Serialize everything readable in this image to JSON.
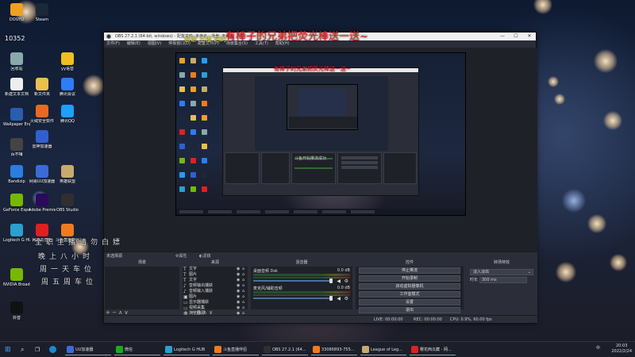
{
  "desktop": {
    "icons": [
      {
        "label": "DOUYU",
        "color": "#f0a020"
      },
      {
        "label": "回收站",
        "color": "#8aa"
      },
      {
        "label": "新建文本文档",
        "color": "#eee"
      },
      {
        "label": "新文件夹",
        "color": "#e8c050"
      },
      {
        "label": "腾讯会议",
        "color": "#2e7cf6"
      },
      {
        "label": "Wallpaper Engine",
        "color": "#2a5db0"
      },
      {
        "label": "百不嗨",
        "color": "#444"
      },
      {
        "label": "Bandizip",
        "color": "#2a7de1"
      },
      {
        "label": "GeForce Experience",
        "color": "#76b900"
      },
      {
        "label": "Logitech G HUB",
        "color": "#2aa0d0"
      },
      {
        "label": "NVIDIA Broadcast",
        "color": "#76b900"
      },
      {
        "label": "抖音",
        "color": "#111"
      },
      {
        "label": "Steam",
        "color": "#1b2838"
      },
      {
        "label": "火绒安全软件",
        "color": "#e86a20"
      },
      {
        "label": "雷神加速器",
        "color": "#3060d0"
      },
      {
        "label": "腾讯QQ",
        "color": "#1e9fff"
      },
      {
        "label": "网易UU加速器",
        "color": "#3c6bd8"
      },
      {
        "label": "Adobe Premiere",
        "color": "#2a0a5a"
      },
      {
        "label": "网易云音乐",
        "color": "#e02020"
      },
      {
        "label": "斗鱼直播伴侣",
        "color": "#f07a20"
      },
      {
        "label": "yy语音",
        "color": "#f0c020"
      },
      {
        "label": "OBS Studio",
        "color": "#302e31"
      },
      {
        "label": "英雄联盟",
        "color": "#c8aa6e"
      }
    ]
  },
  "window": {
    "title": "OBS 27.2.1 (64-bit, windows) - 配置文件: 未命名 - 场景: 未命名",
    "minimize": "—",
    "maximize": "☐",
    "close": "✕",
    "menu": [
      "文件(F)",
      "编辑(E)",
      "视图(V)",
      "停靠窗口(D)",
      "配置文件(P)",
      "场景集合(S)",
      "工具(T)",
      "帮助(H)"
    ]
  },
  "toolbar": {
    "no_source": "未选择源",
    "properties": "⚙属性",
    "filters": "◐滤镜"
  },
  "docks": {
    "scenes": {
      "title": "场景",
      "footer": "+ − ∧ ∨"
    },
    "sources": {
      "title": "来源",
      "items": [
        {
          "label": "文字",
          "icon": "T"
        },
        {
          "label": "图片",
          "icon": "T"
        },
        {
          "label": "文字",
          "icon": "T"
        },
        {
          "label": "音频输出捕获",
          "icon": "♪"
        },
        {
          "label": "音频输入捕获",
          "icon": "♪"
        },
        {
          "label": "图片",
          "icon": "▣"
        },
        {
          "label": "显示器捕获",
          "icon": "▭"
        },
        {
          "label": "视频采集",
          "icon": "▭"
        },
        {
          "label": "浏览器源",
          "icon": "◍"
        }
      ],
      "footer": "+ − ⚙ ∧ ∨"
    },
    "mixer": {
      "title": "混音器",
      "channels": [
        {
          "name": "桌面音频 Dsk",
          "db": "0.0 dB"
        },
        {
          "name": "麦克风/辅助音频",
          "db": "0.0 dB"
        }
      ]
    },
    "controls": {
      "title": "控件",
      "buttons": [
        "停止推流",
        "开始录制",
        "启动虚拟摄像机",
        "工作室模式",
        "设置",
        "退出"
      ]
    },
    "transitions": {
      "title": "转场特效",
      "selected": "淡入淡出",
      "duration_label": "时长",
      "duration_value": "300 ms"
    }
  },
  "status": {
    "live": "LIVE: 00:00:00",
    "rec": "REC: 00:00:00",
    "cpu": "CPU: 0.9%, 60.00 fps"
  },
  "overlay": {
    "top_red_comment": "有棒子的兄弟把荧光棒送一送~",
    "nested_red_comment": "有棒子的兄弟把荧光棒送一送~",
    "left_red_comment": "感谢 主播 送的",
    "desktop_user": "10352",
    "nested_toast": "斗鱼开始推流成功",
    "vertical_text": [
      "全",
      "职",
      "主",
      "播",
      "请",
      "勿",
      "白",
      "嫖",
      "晚",
      "上",
      "八",
      "小",
      "时",
      "周",
      "一",
      "天",
      "车",
      "位",
      "周",
      "五",
      "周",
      "车",
      "位"
    ]
  },
  "taskbar": {
    "apps": [
      {
        "label": "UU加速器",
        "color": "#3c6bd8"
      },
      {
        "label": "微信",
        "color": "#1aad19"
      },
      {
        "label": "Logitech G HUB",
        "color": "#2aa0d0"
      },
      {
        "label": "斗鱼直播伴侣",
        "color": "#f07a20"
      },
      {
        "label": "OBS 27.2.1 (64...",
        "color": "#302e31"
      },
      {
        "label": "33086893-755...",
        "color": "#f07a20"
      },
      {
        "label": "League of Leg...",
        "color": "#c8aa6e"
      },
      {
        "label": "樱花西瓜藏 - 网...",
        "color": "#e02020"
      }
    ],
    "time": "20:03",
    "date": "2022/2/24",
    "ime": "中"
  }
}
